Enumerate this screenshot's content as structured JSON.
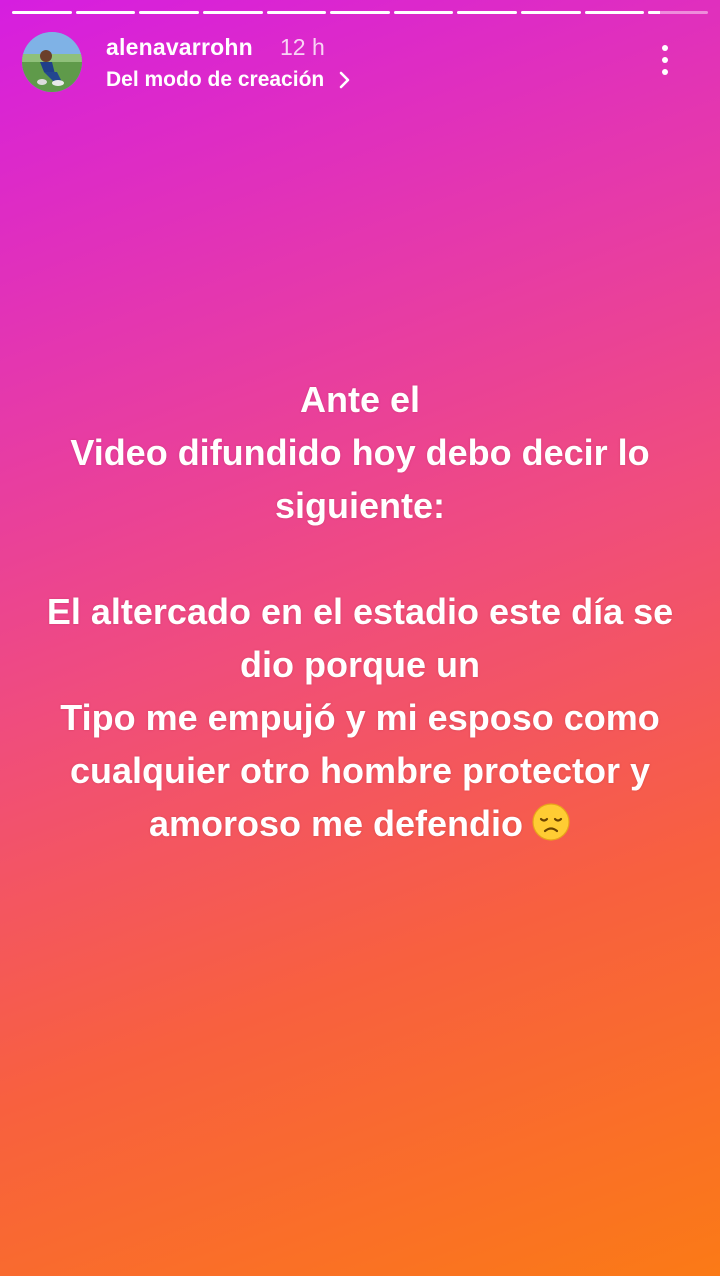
{
  "story": {
    "progress_segments": [
      1,
      1,
      1,
      1,
      1,
      1,
      1,
      1,
      1,
      1,
      0.2
    ],
    "user": {
      "username": "alenavarrohn",
      "time_ago": "12 h",
      "subtitle": "Del modo de creación"
    },
    "message": {
      "lines": [
        "Ante el",
        "Video difundido hoy debo decir lo",
        "siguiente:",
        "",
        "El altercado en el estadio este día se",
        "dio porque un",
        "Tipo me empujó y mi esposo como",
        "cualquier otro hombre protector y",
        "amoroso me defendio"
      ],
      "emoji": "disappointed-face"
    }
  },
  "colors": {
    "gradient_start": "#d61ee0",
    "gradient_end": "#fb7a16",
    "text": "#ffffff"
  }
}
